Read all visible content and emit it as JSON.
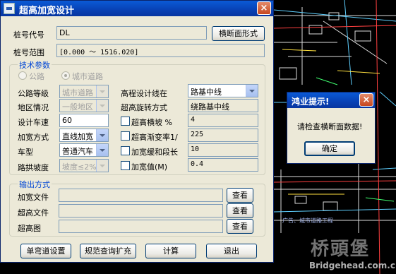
{
  "dialog": {
    "title": "超高加宽设计",
    "close_glyph": "×",
    "stake_code_label": "桩号代号",
    "stake_code_value": "DL",
    "cross_section_button": "横断面形式",
    "stake_range_label": "桩号范围",
    "stake_range_value": "[0.000 ～ 1516.020]",
    "tech_group_title": "技术参数",
    "radio_highway": "公路",
    "radio_city_road": "城市道路",
    "highway_grade_label": "公路等级",
    "highway_grade_value": "城市道路",
    "region_label": "地区情况",
    "region_value": "一般地区",
    "design_speed_label": "设计车速",
    "design_speed_value": "60",
    "widen_method_label": "加宽方式",
    "widen_method_value": "直线加宽",
    "vehicle_label": "车型",
    "vehicle_value": "普通汽车",
    "crown_slope_label": "路拱坡度",
    "crown_slope_value": "坡度≤2%",
    "elev_line_label": "高程设计线在",
    "elev_line_value": "路基中线",
    "rotation_label": "超高旋转方式",
    "rotation_value": "绕路基中线",
    "super_slope_label": "超高横坡 %",
    "super_slope_value": "4",
    "super_ratio_label": "超高渐变率1/",
    "super_ratio_value": "225",
    "widen_len_label": "加宽缓和段长",
    "widen_len_value": "10",
    "widen_val_label": "加宽值(M)",
    "widen_val_value": "0.4",
    "output_group_title": "输出方式",
    "widen_file_label": "加宽文件",
    "super_file_label": "超高文件",
    "super_chart_label": "超高图",
    "view_button": "查看",
    "btn_single_curve": "单弯道设置",
    "btn_spec_query": "规范查询扩充",
    "btn_compute": "计算",
    "btn_exit": "退出"
  },
  "message_box": {
    "title": "鸿业提示!",
    "close_glyph": "×",
    "text": "请检查横断面数据!",
    "ok_button": "确定"
  },
  "background": {
    "cad_label": "广告、城市道路工程",
    "watermark_cn": "桥頭堡",
    "watermark_en": "Bridgehead.com.cn"
  },
  "colors": {
    "title_bar": "#0841b4",
    "dialog_bg": "#ece9d8",
    "group_title": "#0046d5",
    "close_button": "#c7471f"
  }
}
